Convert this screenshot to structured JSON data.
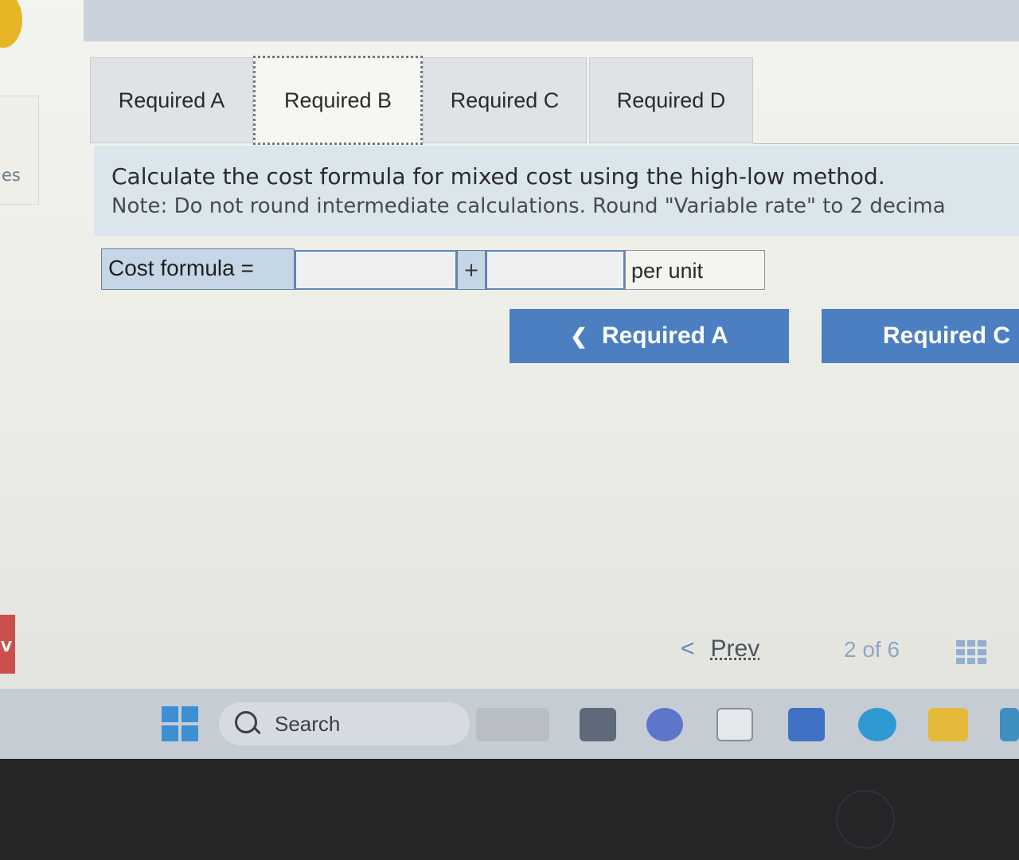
{
  "left_edge": {
    "cut_text": "es",
    "badge_text": "V"
  },
  "tabs": [
    {
      "label": "Required A",
      "active": false
    },
    {
      "label": "Required B",
      "active": true
    },
    {
      "label": "Required C",
      "active": false
    },
    {
      "label": "Required D",
      "active": false
    }
  ],
  "instructions": {
    "main": "Calculate the cost formula for mixed cost using the high-low method.",
    "note": "Note: Do not round intermediate calculations. Round \"Variable rate\" to 2 decima"
  },
  "formula": {
    "label": "Cost formula =",
    "fixed_value": "",
    "operator": "+",
    "variable_value": "",
    "unit_label": "per unit"
  },
  "nav": {
    "prev_label": "Required A",
    "next_label": "Required C"
  },
  "pager": {
    "prev_label": "Prev",
    "page_current": "2",
    "page_of": "of",
    "page_total": "6"
  },
  "taskbar": {
    "search_label": "Search",
    "icons": [
      "windows-start-icon",
      "search-icon",
      "widgets-icon",
      "task-view-icon",
      "teams-icon",
      "store-icon",
      "word-icon",
      "edge-icon",
      "file-explorer-icon",
      "app-icon"
    ]
  },
  "colors": {
    "accent_button": "#4b7fc1",
    "instruction_bg": "#dae6ec",
    "formula_label_bg": "#c5d6e6",
    "input_border": "#5f86b8"
  }
}
